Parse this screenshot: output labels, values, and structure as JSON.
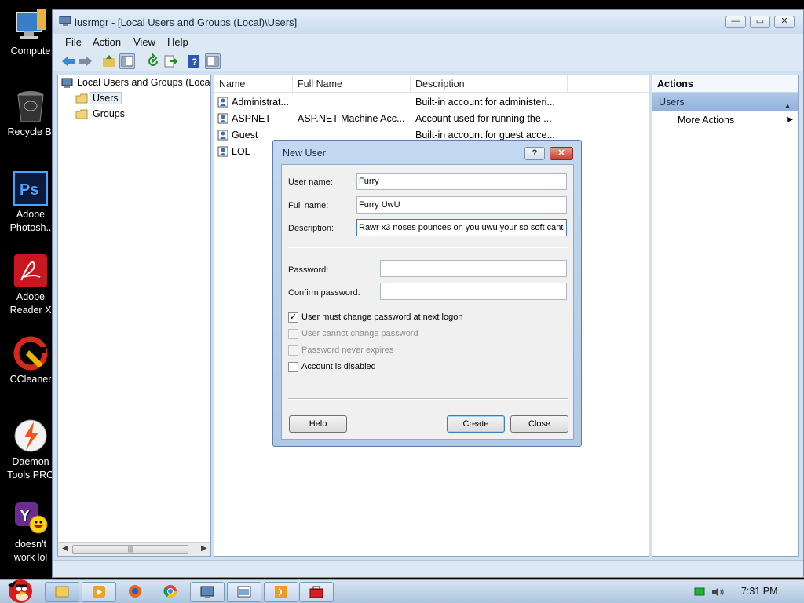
{
  "desktop": {
    "icons": [
      {
        "label": "Compute",
        "icon": "computer-icon"
      },
      {
        "label": "Recycle Bi",
        "icon": "recycle-bin-icon"
      },
      {
        "label": "Adobe",
        "label2": "Photosh..",
        "icon": "photoshop-icon"
      },
      {
        "label": "Adobe",
        "label2": "Reader X",
        "icon": "adobe-reader-icon"
      },
      {
        "label": "CCleaner",
        "icon": "ccleaner-icon"
      },
      {
        "label": "Daemon",
        "label2": "Tools PRO",
        "icon": "daemon-tools-icon"
      },
      {
        "label": "doesn't",
        "label2": "work lol",
        "icon": "yahoo-messenger-icon"
      }
    ]
  },
  "window": {
    "title": "lusrmgr - [Local Users and Groups (Local)\\Users]",
    "menu": [
      "File",
      "Action",
      "View",
      "Help"
    ]
  },
  "tree": {
    "root": "Local Users and Groups (Loca",
    "items": [
      "Users",
      "Groups"
    ]
  },
  "list": {
    "columns": [
      "Name",
      "Full Name",
      "Description"
    ],
    "rows": [
      {
        "name": "Administrat...",
        "full_name": "",
        "description": "Built-in account for administeri..."
      },
      {
        "name": "ASPNET",
        "full_name": "ASP.NET Machine Acc...",
        "description": "Account used for running the ..."
      },
      {
        "name": "Guest",
        "full_name": "",
        "description": "Built-in account for guest acce..."
      },
      {
        "name": "LOL",
        "full_name": "",
        "description": ""
      }
    ]
  },
  "actions": {
    "header": "Actions",
    "section": "Users",
    "item": "More Actions"
  },
  "dialog": {
    "title": "New User",
    "help_glyph": "?",
    "close_glyph": "✕",
    "username_label": "User name:",
    "username_value": "Furry",
    "fullname_label": "Full name:",
    "fullname_value": "Furry UwU",
    "description_label": "Description:",
    "description_value": "Rawr x3 noses pounces on you uwu your so soft cant",
    "password_label": "Password:",
    "confirm_label": "Confirm password:",
    "checkboxes": [
      {
        "label": "User must change password at next logon",
        "checked": true,
        "enabled": true
      },
      {
        "label": "User cannot change password",
        "checked": false,
        "enabled": false
      },
      {
        "label": "Password never expires",
        "checked": false,
        "enabled": false
      },
      {
        "label": "Account is disabled",
        "checked": false,
        "enabled": true
      }
    ],
    "help_button": "Help",
    "create_button": "Create",
    "close_button": "Close"
  },
  "taskbar": {
    "time": "7:31 PM"
  }
}
